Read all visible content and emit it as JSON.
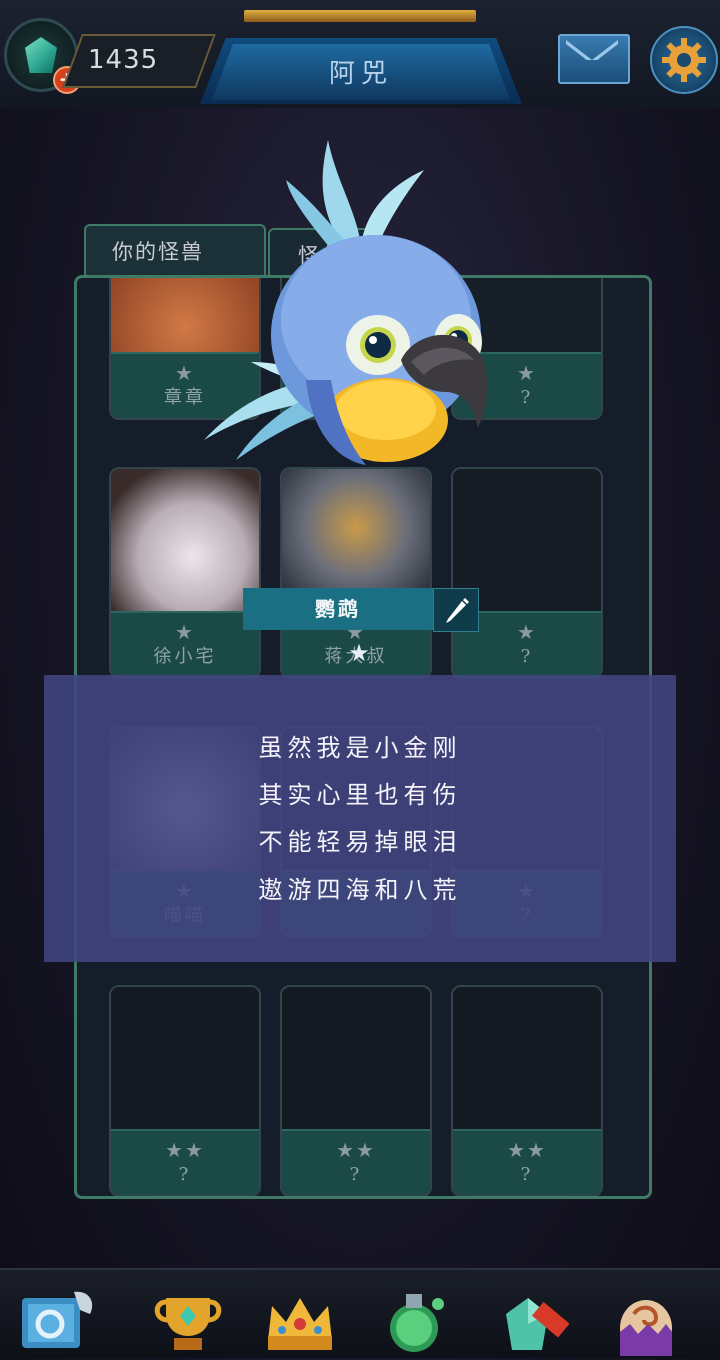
{
  "header": {
    "currency": "1435",
    "title": "阿兕",
    "add_symbol": "+"
  },
  "tabs": [
    {
      "label": "你的怪兽"
    },
    {
      "label": "怪兽"
    }
  ],
  "monsters": [
    {
      "stars": "★",
      "name": "章章"
    },
    {
      "stars": "★",
      "name": ""
    },
    {
      "stars": "★",
      "name": "?"
    },
    {
      "stars": "★",
      "name": "徐小宅"
    },
    {
      "stars": "★",
      "name": "蒋大叔"
    },
    {
      "stars": "★",
      "name": "?"
    },
    {
      "stars": "★",
      "name": "喵喵"
    },
    {
      "stars": "★",
      "name": ""
    },
    {
      "stars": "★",
      "name": "?"
    },
    {
      "stars": "★★",
      "name": "?"
    },
    {
      "stars": "★★",
      "name": "?"
    },
    {
      "stars": "★★",
      "name": "?"
    }
  ],
  "selected_pet": {
    "name": "鹦鹉",
    "stars": "★"
  },
  "poem": [
    "虽然我是小金刚",
    "其实心里也有伤",
    "不能轻易掉眼泪",
    "遨游四海和八荒"
  ],
  "colors": {
    "accent_teal": "#1b6f82",
    "panel_border": "#3f7a66",
    "overlay": "#42468a"
  },
  "icons": [
    "gem-icon",
    "mail-icon",
    "gear-icon",
    "edit-icon",
    "book-icon",
    "trophy-icon",
    "crown-icon",
    "potion-icon",
    "shop-sale-icon",
    "egg-icon"
  ]
}
